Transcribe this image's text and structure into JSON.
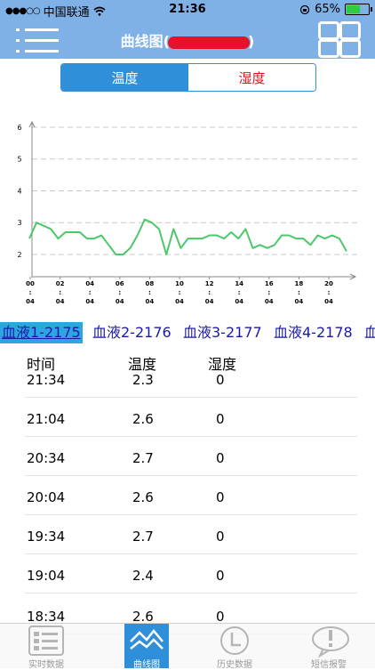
{
  "status": {
    "carrier": "中国联通",
    "time": "21:36",
    "battery": "65%",
    "battery_level": 0.65
  },
  "header": {
    "title_prefix": "曲线图(",
    "title_suffix": ")"
  },
  "segment": {
    "temperature": "温度",
    "humidity": "湿度"
  },
  "chart_data": {
    "type": "line",
    "y_ticks": [
      "6",
      "5",
      "4",
      "3",
      "2"
    ],
    "ylim": [
      1.3,
      6
    ],
    "x_ticks": [
      [
        "00",
        ":",
        "04"
      ],
      [
        "02",
        ":",
        "04"
      ],
      [
        "04",
        ":",
        "04"
      ],
      [
        "06",
        ":",
        "04"
      ],
      [
        "08",
        ":",
        "04"
      ],
      [
        "10",
        ":",
        "04"
      ],
      [
        "12",
        ":",
        "04"
      ],
      [
        "14",
        ":",
        "04"
      ],
      [
        "16",
        ":",
        "04"
      ],
      [
        "18",
        ":",
        "04"
      ],
      [
        "20",
        ":",
        "04"
      ]
    ],
    "series": [
      {
        "color": "#4cc86a",
        "values": [
          2.5,
          3.0,
          2.9,
          2.8,
          2.5,
          2.7,
          2.7,
          2.7,
          2.5,
          2.5,
          2.6,
          2.3,
          2.0,
          2.0,
          2.2,
          2.6,
          3.1,
          3.0,
          2.8,
          2.0,
          2.8,
          2.2,
          2.5,
          2.5,
          2.5,
          2.6,
          2.6,
          2.5,
          2.7,
          2.5,
          2.8,
          2.2,
          2.3,
          2.2,
          2.3,
          2.6,
          2.6,
          2.5,
          2.5,
          2.3,
          2.6,
          2.5,
          2.6,
          2.5,
          2.1
        ]
      }
    ]
  },
  "device_tabs": [
    "血液1-2175",
    "血液2-2176",
    "血液3-2177",
    "血液4-2178",
    "血"
  ],
  "table": {
    "headers": {
      "time": "时间",
      "temperature": "温度",
      "humidity": "湿度"
    },
    "rows": [
      {
        "time": "21:34",
        "temp": "2.3",
        "hum": "0"
      },
      {
        "time": "21:04",
        "temp": "2.6",
        "hum": "0"
      },
      {
        "time": "20:34",
        "temp": "2.7",
        "hum": "0"
      },
      {
        "time": "20:04",
        "temp": "2.6",
        "hum": "0"
      },
      {
        "time": "19:34",
        "temp": "2.7",
        "hum": "0"
      },
      {
        "time": "19:04",
        "temp": "2.4",
        "hum": "0"
      },
      {
        "time": "18:34",
        "temp": "2.6",
        "hum": "0"
      }
    ]
  },
  "tabbar": [
    {
      "label": "实时数据",
      "icon": "list-icon",
      "active": false
    },
    {
      "label": "曲线图",
      "icon": "line-chart-icon",
      "active": true
    },
    {
      "label": "历史数据",
      "icon": "clock-icon",
      "active": false
    },
    {
      "label": "短信报警",
      "icon": "alert-bubble-icon",
      "active": false
    }
  ]
}
